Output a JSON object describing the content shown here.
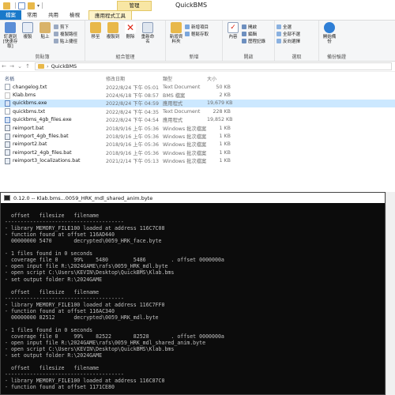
{
  "explorer": {
    "context_tab_header": "管理",
    "title": "QuickBMS",
    "tabs": [
      "檔案",
      "常用",
      "共用",
      "檢視",
      "應用程式工具"
    ],
    "ribbon": {
      "clipboard": {
        "label": "剪貼簿",
        "pin_label": "釘選到[快速存取]",
        "copy_label": "複製",
        "paste_label": "貼上",
        "cut_label": "剪下",
        "copy_path_label": "複製路徑",
        "paste_shortcut_label": "貼上捷徑"
      },
      "organize": {
        "label": "組合管理",
        "move_label": "移至",
        "copyto_label": "複製到",
        "delete_label": "刪除",
        "rename_label": "重新命名"
      },
      "new": {
        "label": "新增",
        "new_folder_label": "新增資料夾",
        "new_item_label": "新增項目",
        "easy_access_label": "輕鬆存取"
      },
      "open": {
        "label": "開啟",
        "properties_label": "內容",
        "open_label": "開啟",
        "edit_label": "編輯",
        "history_label": "歷程記錄"
      },
      "select": {
        "label": "選取",
        "select_all_label": "全選",
        "select_none_label": "全部不選",
        "invert_label": "反向選擇"
      },
      "onedrive": {
        "label": "備份驗證",
        "backup_label": "開始備份"
      }
    },
    "address": {
      "path": "QuickBMS"
    },
    "columns": {
      "name": "名稱",
      "date": "修改日期",
      "type": "類型",
      "size": "大小"
    },
    "files": [
      {
        "name": "changelog.txt",
        "date": "2022/8/24 下午 05:01",
        "type": "Text Document",
        "size": "50 KB",
        "kind": "txt"
      },
      {
        "name": "Klab.bms",
        "date": "2024/6/18 下午 08:57",
        "type": "BMS 檔案",
        "size": "2 KB",
        "kind": "bms"
      },
      {
        "name": "quickbms.exe",
        "date": "2022/8/24 下午 04:59",
        "type": "應用程式",
        "size": "19,679 KB",
        "kind": "exe",
        "selected": true
      },
      {
        "name": "quickbms.txt",
        "date": "2022/8/24 下午 04:35",
        "type": "Text Document",
        "size": "228 KB",
        "kind": "txt"
      },
      {
        "name": "quickbms_4gb_files.exe",
        "date": "2022/8/24 下午 04:54",
        "type": "應用程式",
        "size": "19,852 KB",
        "kind": "exe"
      },
      {
        "name": "reimport.bat",
        "date": "2018/9/16 上午 05:36",
        "type": "Windows 批次檔案",
        "size": "1 KB",
        "kind": "bat"
      },
      {
        "name": "reimport_4gb_files.bat",
        "date": "2018/9/16 上午 05:36",
        "type": "Windows 批次檔案",
        "size": "1 KB",
        "kind": "bat"
      },
      {
        "name": "reimport2.bat",
        "date": "2018/9/16 上午 05:36",
        "type": "Windows 批次檔案",
        "size": "1 KB",
        "kind": "bat"
      },
      {
        "name": "reimport2_4gb_files.bat",
        "date": "2018/9/16 上午 05:36",
        "type": "Windows 批次檔案",
        "size": "1 KB",
        "kind": "bat"
      },
      {
        "name": "reimport3_localizations.bat",
        "date": "2021/2/14 下午 05:13",
        "type": "Windows 批次檔案",
        "size": "1 KB",
        "kind": "bat"
      }
    ]
  },
  "console": {
    "title": "0.12.0 -- Klab.bms...0059_HRK_mdl_shared_anim.byte",
    "lines": [
      "",
      "  offset   filesize   filename",
      "--------------------------------------",
      "- library MEMORY_FILE100 loaded at address 116C7C08",
      "- function found at offset 116AD440",
      "  00000000 5470       decrypted\\0059_HRK_face.byte",
      "",
      "- 1 files found in 0 seconds",
      "  coverage file 0     99%    5480        5486        . offset 0000000a",
      "- open input file R:\\2024GAME\\rafs\\0059_HRK_mdl.byte",
      "- open script C:\\Users\\KEVIN\\Desktop\\QuickBMS\\Klab.bms",
      "- set output folder R:\\2024GAME",
      "",
      "  offset   filesize   filename",
      "--------------------------------------",
      "- library MEMORY_FILE100 loaded at address 116C7FF0",
      "- function found at offset 116AC340",
      "  00000000 82512      decrypted\\0059_HRK_mdl.byte",
      "",
      "- 1 files found in 0 seconds",
      "  coverage file 0     99%    82522       82528       . offset 0000000a",
      "- open input file R:\\2024GAME\\rafs\\0059_HRK_mdl_shared_anim.byte",
      "- open script C:\\Users\\KEVIN\\Desktop\\QuickBMS\\Klab.bms",
      "- set output folder R:\\2024GAME",
      "",
      "  offset   filesize   filename",
      "--------------------------------------",
      "- library MEMORY_FILE100 loaded at address 116C87C0",
      "- function found at offset 1171CE80"
    ]
  },
  "colors": {
    "file_tab": "#1979ca",
    "selection": "#cce8ff",
    "context_tab": "#f8e6a4",
    "console_bg": "#0c0c0c",
    "console_text": "#c0c0c0"
  }
}
